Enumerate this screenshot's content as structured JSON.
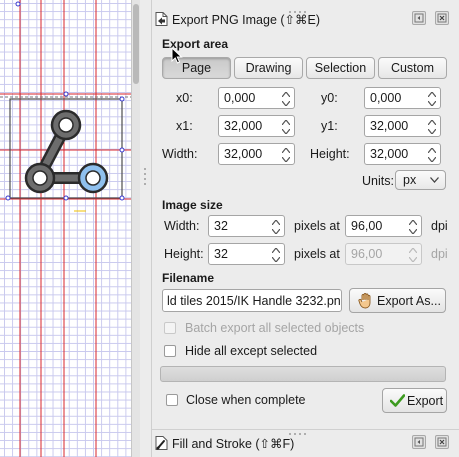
{
  "export_panel": {
    "title": "Export PNG Image (⇧⌘E)",
    "export_area": {
      "label": "Export area",
      "modes": [
        "Page",
        "Drawing",
        "Selection",
        "Custom"
      ],
      "active_mode": "Page",
      "x0": {
        "label": "x0:",
        "value": "0,000"
      },
      "y0": {
        "label": "y0:",
        "value": "0,000"
      },
      "x1": {
        "label": "x1:",
        "value": "32,000"
      },
      "y1": {
        "label": "y1:",
        "value": "32,000"
      },
      "width": {
        "label": "Width:",
        "value": "32,000"
      },
      "height": {
        "label": "Height:",
        "value": "32,000"
      },
      "units_label": "Units:",
      "units_value": "px"
    },
    "image_size": {
      "label": "Image size",
      "width_label": "Width:",
      "width_value": "32",
      "height_label": "Height:",
      "height_value": "32",
      "pixels_at": "pixels at",
      "dpi_value": "96,00",
      "dpi_value_disabled": "96,00",
      "dpi_label": "dpi"
    },
    "filename": {
      "label": "Filename",
      "value": "ld tiles 2015/IK Handle 3232.png",
      "export_as_label": "Export As..."
    },
    "options": {
      "batch_export": "Batch export all selected objects",
      "hide_all_except": "Hide all except selected",
      "close_when_complete": "Close when complete"
    },
    "progress": 0,
    "export_button": "Export"
  },
  "fill_stroke_panel": {
    "title": "Fill and Stroke (⇧⌘F)"
  },
  "canvas": {
    "grid_color": "#c9c9ee",
    "guide_color": "#d8262b",
    "node_fill": "#6d6d6d",
    "selected_node_fill": "#8fc0ee",
    "node_stroke": "#2b2b2b"
  },
  "icons": [
    "export-png-icon",
    "fill-stroke-icon",
    "dock-icon",
    "close-icon",
    "checkmark-icon",
    "folder-icon"
  ]
}
